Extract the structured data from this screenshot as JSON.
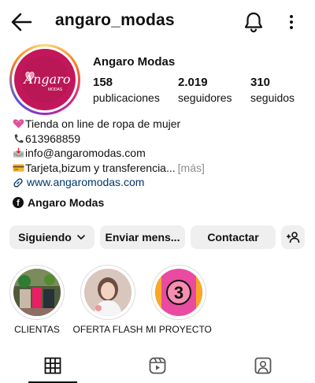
{
  "header": {
    "username": "angaro_modas",
    "back_icon": "arrow-left-icon",
    "notifications_icon": "bell-icon",
    "more_icon": "more-vertical-icon"
  },
  "profile": {
    "display_name": "Angaro Modas",
    "avatar_text": "Angaro",
    "avatar_subtext": "MODAS",
    "colors": {
      "avatar_bg": "#c2185b",
      "link": "#00376b",
      "muted": "#8e8e8e",
      "button_bg": "#efefef"
    },
    "stats": [
      {
        "value": "158",
        "label": "publicaciones"
      },
      {
        "value": "2.019",
        "label": "seguidores"
      },
      {
        "value": "310",
        "label": "seguidos"
      }
    ]
  },
  "bio": {
    "lines": [
      {
        "icon": "heart-emoji",
        "text": "Tienda on line de ropa de mujer"
      },
      {
        "icon": "telephone-emoji",
        "text": "613968859"
      },
      {
        "icon": "inbox-emoji",
        "text": "info@angaromodas.com"
      },
      {
        "icon": "credit-card-emoji",
        "text": "Tarjeta,bizum y transferencia..."
      }
    ],
    "more_label": "[más]",
    "link": "www.angaromodas.com",
    "facebook_name": "Angaro Modas"
  },
  "actions": {
    "following_label": "Siguiendo",
    "message_label": "Enviar mens...",
    "contact_label": "Contactar",
    "add_person_icon": "add-person-icon"
  },
  "highlights": [
    {
      "label": "CLIENTAS"
    },
    {
      "label": "OFERTA FLASH"
    },
    {
      "label": "MI PROYECTO",
      "badge": "3"
    }
  ],
  "tabs": [
    {
      "icon": "grid-icon",
      "active": true
    },
    {
      "icon": "reels-icon",
      "active": false
    },
    {
      "icon": "tagged-icon",
      "active": false
    }
  ]
}
